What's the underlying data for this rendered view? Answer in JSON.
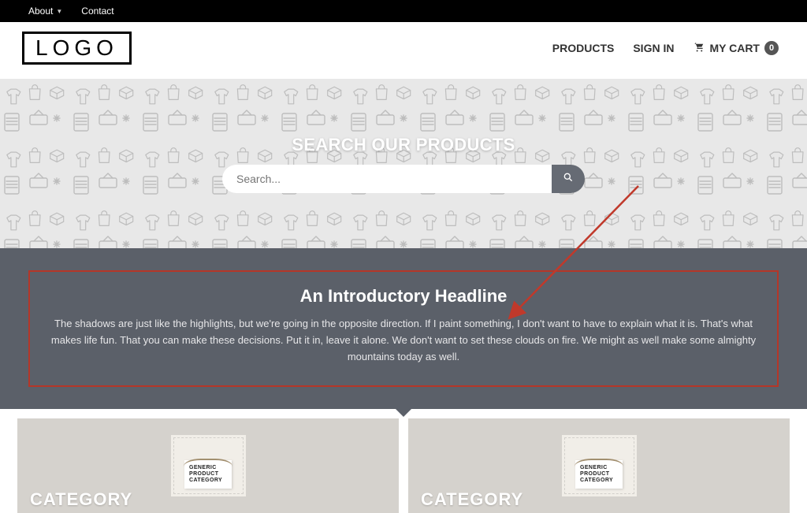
{
  "topbar": {
    "about": "About",
    "contact": "Contact"
  },
  "header": {
    "logo_text": "LOGO",
    "nav": {
      "products": "PRODUCTS",
      "signin": "SIGN IN",
      "cart_label": "MY CART",
      "cart_count": "0"
    }
  },
  "hero": {
    "title": "SEARCH OUR PRODUCTS",
    "search_placeholder": "Search..."
  },
  "intro": {
    "headline": "An Introductory Headline",
    "body": "The shadows are just like the highlights, but we're going in the opposite direction. If I paint something, I don't want to have to explain what it is. That's what makes life fun. That you can make these decisions. Put it in, leave it alone. We don't want to set these clouds on fire. We might as well make some almighty mountains today as well."
  },
  "categories": [
    {
      "label": "CATEGORY",
      "tag_line1": "GENERIC",
      "tag_line2": "PRODUCT",
      "tag_line3": "CATEGORY"
    },
    {
      "label": "CATEGORY",
      "tag_line1": "GENERIC",
      "tag_line2": "PRODUCT",
      "tag_line3": "CATEGORY"
    }
  ],
  "annotation": {
    "highlight_color": "#b53628"
  }
}
